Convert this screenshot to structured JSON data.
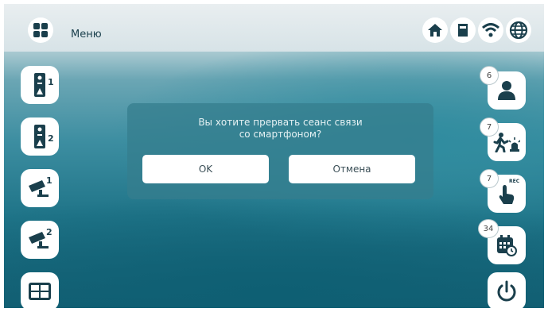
{
  "header": {
    "menu_label": "Меню"
  },
  "status_icons": [
    "home-icon",
    "sd-card-icon",
    "wifi-icon",
    "globe-icon"
  ],
  "left_panel": [
    {
      "name": "door-panel-1-icon",
      "number": "1"
    },
    {
      "name": "door-panel-2-icon",
      "number": "2"
    },
    {
      "name": "camera-1-icon",
      "number": "1"
    },
    {
      "name": "camera-2-icon",
      "number": "2"
    },
    {
      "name": "split-screen-icon",
      "number": ""
    }
  ],
  "right_panel": {
    "users_badge": "6",
    "motion_badge": "7",
    "record_badge": "7",
    "record_label": "REC",
    "calendar_badge": "34"
  },
  "dialog": {
    "line1": "Вы хотите прервать сеанс связи",
    "line2": "со смартфоном?",
    "ok_label": "OK",
    "cancel_label": "Отмена"
  },
  "colors": {
    "accent": "#1f6b80",
    "icon": "#1a3f4c",
    "dialog_bg": "#367e8e"
  }
}
